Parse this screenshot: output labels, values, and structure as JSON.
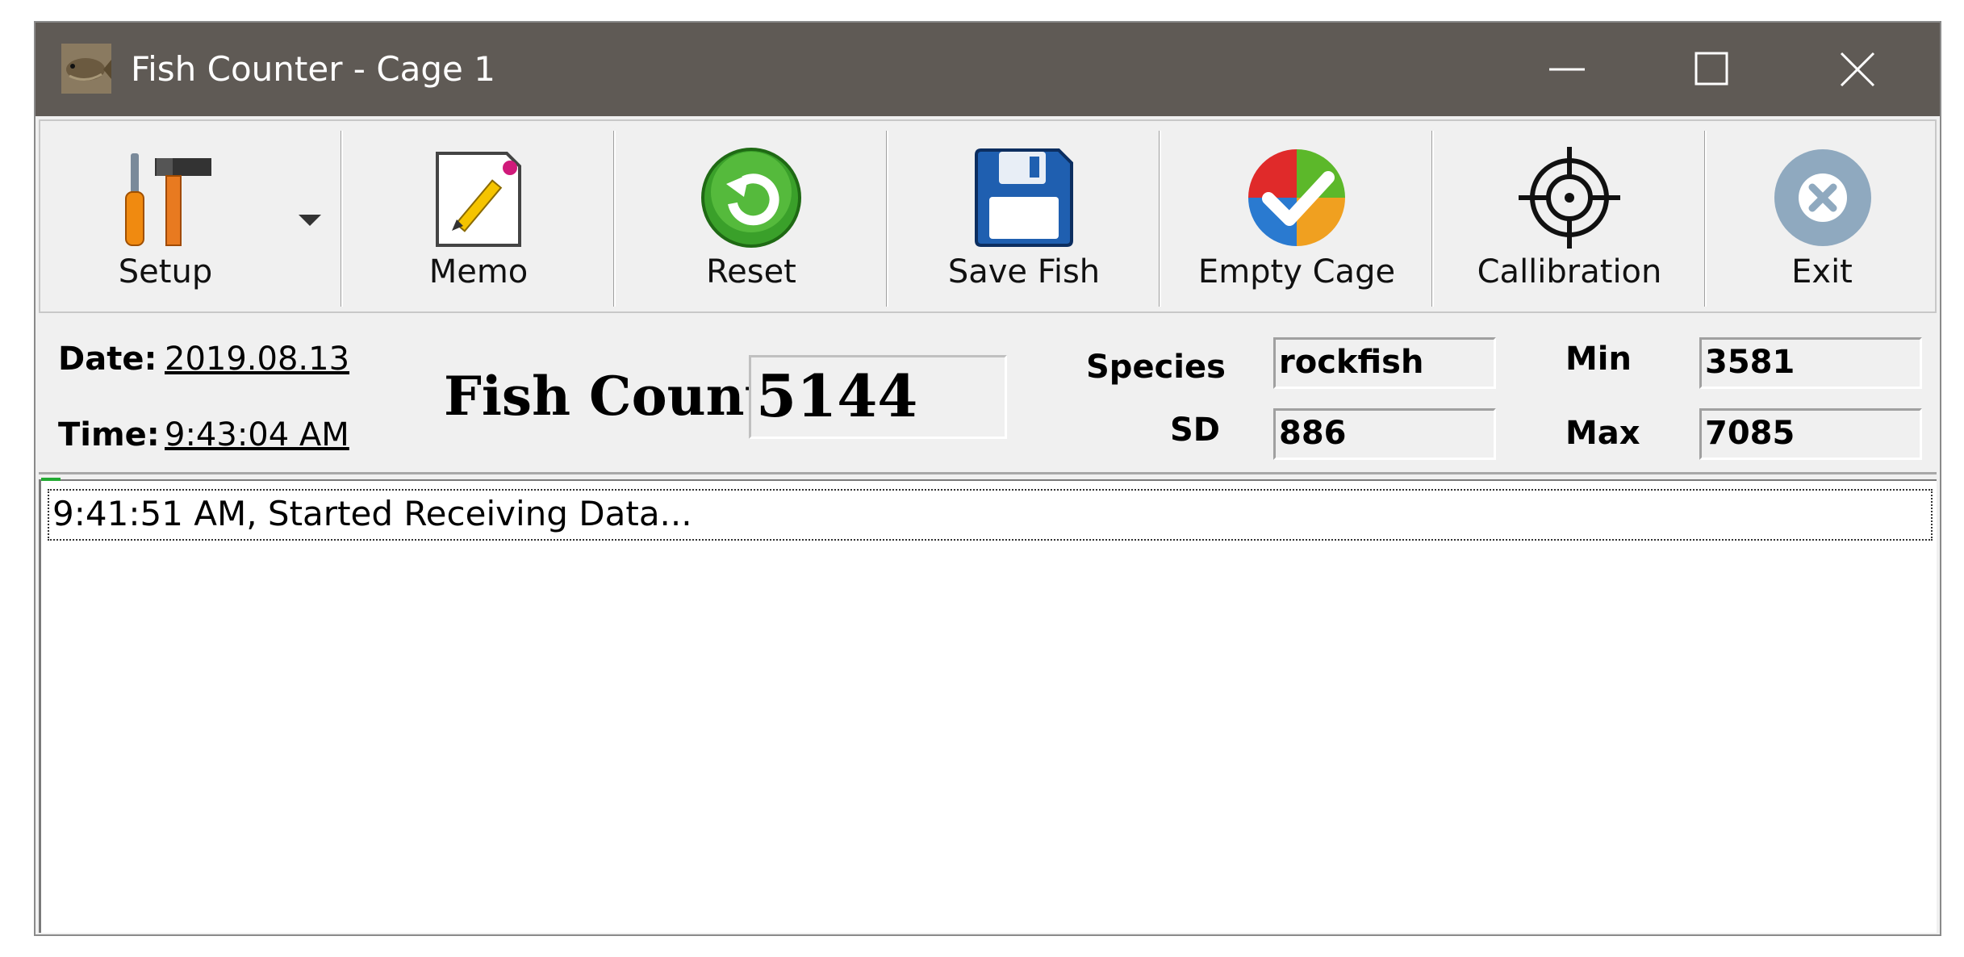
{
  "window": {
    "title": "Fish Counter - Cage 1"
  },
  "toolbar": {
    "setup_label": "Setup",
    "memo_label": "Memo",
    "reset_label": "Reset",
    "save_fish_label": "Save Fish",
    "empty_cage_label": "Empty Cage",
    "calibration_label": "Callibration",
    "exit_label": "Exit"
  },
  "info": {
    "date_label": "Date:",
    "date_value": "2019.08.13",
    "time_label": "Time:",
    "time_value": "9:43:04 AM",
    "fish_count_label": "Fish Count",
    "fish_count_value": "5144",
    "species_label": "Species",
    "species_value": "rockfish",
    "sd_label": "SD",
    "sd_value": "886",
    "min_label": "Min",
    "min_value": "3581",
    "max_label": "Max",
    "max_value": "7085"
  },
  "log": {
    "entries": [
      "9:41:51 AM, Started Receiving Data..."
    ]
  },
  "icons": {
    "app": "fish-icon",
    "setup": "tools-icon",
    "memo": "memo-pencil-icon",
    "reset": "reset-refresh-icon",
    "save": "floppy-disk-icon",
    "empty": "check-circle-icon",
    "calibration": "crosshair-icon",
    "exit": "exit-x-icon"
  },
  "colors": {
    "titlebar": "#5f5a55",
    "toolbar_bg": "#f0f0f0",
    "reset_green": "#3aa02a",
    "save_blue": "#1f5fb0",
    "exit_blue": "#8fa9bf"
  }
}
